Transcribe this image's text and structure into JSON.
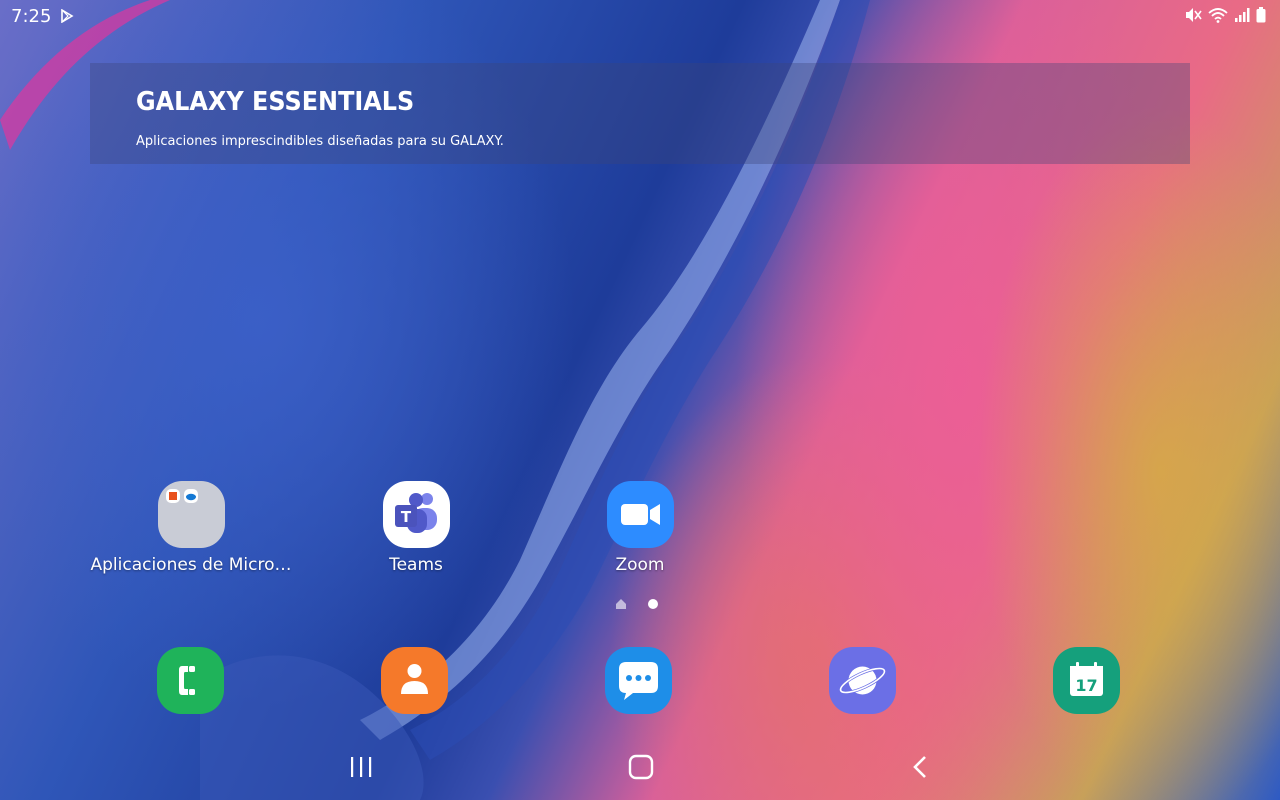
{
  "status_bar": {
    "time": "7:25",
    "icons": [
      "play-store-icon",
      "mute-icon",
      "wifi-icon",
      "signal-icon",
      "battery-icon"
    ]
  },
  "widget": {
    "title": "GALAXY ESSENTIALS",
    "subtitle": "Aplicaciones imprescindibles diseñadas para su GALAXY."
  },
  "apps": [
    {
      "label": "Aplicaciones de Micro…",
      "icon": "folder-icon"
    },
    {
      "label": "Teams",
      "icon": "teams-icon"
    },
    {
      "label": "Zoom",
      "icon": "zoom-icon"
    }
  ],
  "dock": [
    {
      "icon": "phone-icon",
      "color": "#1fb35a"
    },
    {
      "icon": "contacts-icon",
      "color": "#f5792a"
    },
    {
      "icon": "messages-icon",
      "color": "#1e8ee8"
    },
    {
      "icon": "internet-icon",
      "color": "#6b6fe6"
    },
    {
      "icon": "calendar-icon",
      "color": "#15a07c",
      "text": "17"
    }
  ],
  "colors": {
    "phone": "#1fb35a",
    "contacts": "#f5792a",
    "messages": "#1e8ee8",
    "internet": "#6b6fe6",
    "calendar": "#15a07c",
    "zoom": "#2d8cff",
    "teams": "#5059c9"
  }
}
